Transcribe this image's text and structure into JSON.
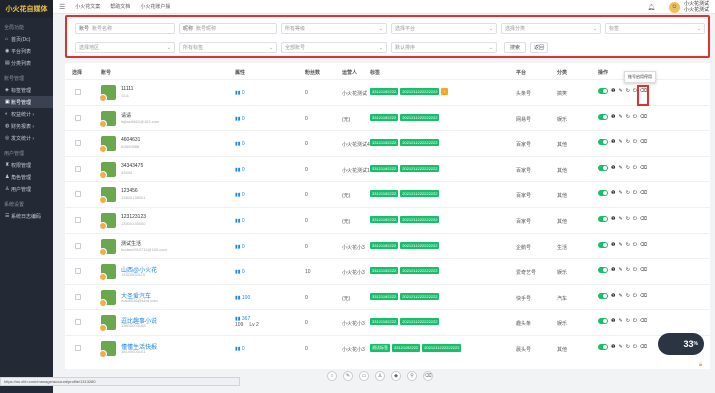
{
  "sidebar": {
    "logo": "小火花自媒体",
    "sections": [
      {
        "title": "全局功能",
        "items": [
          {
            "icon": "home-icon",
            "glyph": "⌂",
            "label": "首页(Dc)"
          },
          {
            "icon": "platform-icon",
            "glyph": "◉",
            "label": "平台列表"
          },
          {
            "icon": "category-icon",
            "glyph": "▤",
            "label": "分类列表"
          }
        ]
      },
      {
        "title": "账号管理",
        "items": [
          {
            "icon": "tag-icon",
            "glyph": "◈",
            "label": "标签管理"
          },
          {
            "icon": "account-icon",
            "glyph": "▣",
            "label": "账号管理",
            "active": true
          },
          {
            "icon": "stats-icon",
            "glyph": "◐",
            "label": "权益统计 ›"
          },
          {
            "icon": "finance-icon",
            "glyph": "◍",
            "label": "财务报表 ›"
          },
          {
            "icon": "publish-icon",
            "glyph": "◎",
            "label": "发文统计 ›"
          }
        ]
      },
      {
        "title": "用户管理",
        "items": [
          {
            "icon": "permission-icon",
            "glyph": "♜",
            "label": "权限管理"
          },
          {
            "icon": "role-icon",
            "glyph": "♟",
            "label": "角色管理"
          },
          {
            "icon": "user-icon",
            "glyph": "♙",
            "label": "用户管理"
          }
        ]
      },
      {
        "title": "系统设置",
        "items": [
          {
            "icon": "log-icon",
            "glyph": "☰",
            "label": "系统日志编码"
          }
        ]
      }
    ]
  },
  "topbar": {
    "menu": [
      "小火花文案",
      "帮助文档",
      "小火花账户操"
    ],
    "user_line1": "小火花测试",
    "user_line2": "小火花测试"
  },
  "filter": {
    "account_label": "账号",
    "account_placeholder": "账号名称",
    "nick_label": "昵称",
    "nick_placeholder": "账号昵称",
    "group_placeholder": "所有等级",
    "platform_placeholder": "选择平台",
    "category_placeholder": "选择分类",
    "tag_placeholder": "标签",
    "location_placeholder": "选择地区",
    "level_placeholder": "所有标签",
    "account_kind_placeholder": "全部账号",
    "sort_placeholder": "默认排序",
    "search_btn": "搜索",
    "reset_btn": "返回"
  },
  "table": {
    "headers": {
      "select": "选择",
      "account": "账号",
      "attr": "属性",
      "fans": "粉丝数",
      "operator": "运营人",
      "tags": "标签",
      "platform": "平台",
      "category": "分类",
      "ops": "操作"
    },
    "rows": [
      {
        "name": "11111",
        "sub": "1111",
        "attr": "0",
        "fans": "0",
        "operator": "小火花测试",
        "tags": [
          "33121192222",
          "2021211222222222"
        ],
        "has_y": true,
        "platform": "头条号",
        "category": "搞笑"
      },
      {
        "name": "请请",
        "sub": "fsjksk9862@163.com",
        "attr": "0",
        "fans": "0",
        "operator": "(无)",
        "tags": [
          "33121192222",
          "2021211222222222"
        ],
        "has_y": false,
        "platform": "网易号",
        "category": "娱乐"
      },
      {
        "name": "4604631",
        "sub": "B4599588",
        "attr": "0",
        "fans": "0",
        "operator": "小火花测试4",
        "tags": [
          "33121192222",
          "2021211222222222"
        ],
        "has_y": false,
        "platform": "百家号",
        "category": "其他"
      },
      {
        "name": "34343475",
        "sub": "43434",
        "attr": "0",
        "fans": "0",
        "operator": "小火花测试1",
        "tags": [
          "33121192222",
          "2021211222222222"
        ],
        "has_y": false,
        "platform": "百家号",
        "category": "其他"
      },
      {
        "name": "123456",
        "sub": "13800138001",
        "attr": "0",
        "fans": "0",
        "operator": "(无)",
        "tags": [
          "33121192222",
          "2021211222222222"
        ],
        "has_y": false,
        "platform": "百家号",
        "category": "其他"
      },
      {
        "name": "123123123",
        "sub": "13500135000",
        "attr": "0",
        "fans": "0",
        "operator": "(无)",
        "tags": [
          "33121192222",
          "2021211222222222"
        ],
        "has_y": false,
        "platform": "百家号",
        "category": "其他"
      },
      {
        "name": "测试生活",
        "sub": "hudanri910711@163.com",
        "attr": "0",
        "fans": "0",
        "operator": "小火花小3",
        "tags": [
          "33121192222",
          "2021211222222222"
        ],
        "has_y": false,
        "platform": "企鹅号",
        "category": "生活"
      },
      {
        "name": "山西@小火花",
        "sub": "13320550115",
        "attr": "0",
        "fans": "10",
        "operator": "小火花小3",
        "tags": [
          "33121192222",
          "2021211222222222"
        ],
        "has_y": false,
        "platform": "爱奇艺号",
        "category": "娱乐",
        "blue": true
      },
      {
        "name": "大圣爱汽车",
        "sub": "mao6536@sina.com",
        "attr": "100",
        "fans": "0",
        "operator": "(无)",
        "tags": [
          "33121192222",
          "2021211222222222"
        ],
        "has_y": false,
        "platform": "快手号",
        "category": "汽车",
        "blue": true
      },
      {
        "name": "逗比趣事小说",
        "sub": "13600000168",
        "attr": "367",
        "attr2": "109",
        "lv": "Lv 2",
        "fans": "0",
        "operator": "小火花小3",
        "tags": [
          "33121192222",
          "2021211222222222"
        ],
        "has_y": false,
        "platform": "趣头条",
        "category": "娱乐",
        "blue": true
      },
      {
        "name": "懂懂生活快报",
        "sub": "18140000101",
        "attr": "0",
        "fans": "0",
        "operator": "小火花小3",
        "tags": [
          "测试标签",
          "33121192222",
          "2021211222222222"
        ],
        "has_y": false,
        "platform": "晨头号",
        "category": "其他",
        "blue": true
      }
    ]
  },
  "tooltip": "账号启用停用",
  "status_url": "https://ss.xhh.com/manage/account/profile/1313280",
  "speed": {
    "value": "33",
    "unit": "%"
  }
}
